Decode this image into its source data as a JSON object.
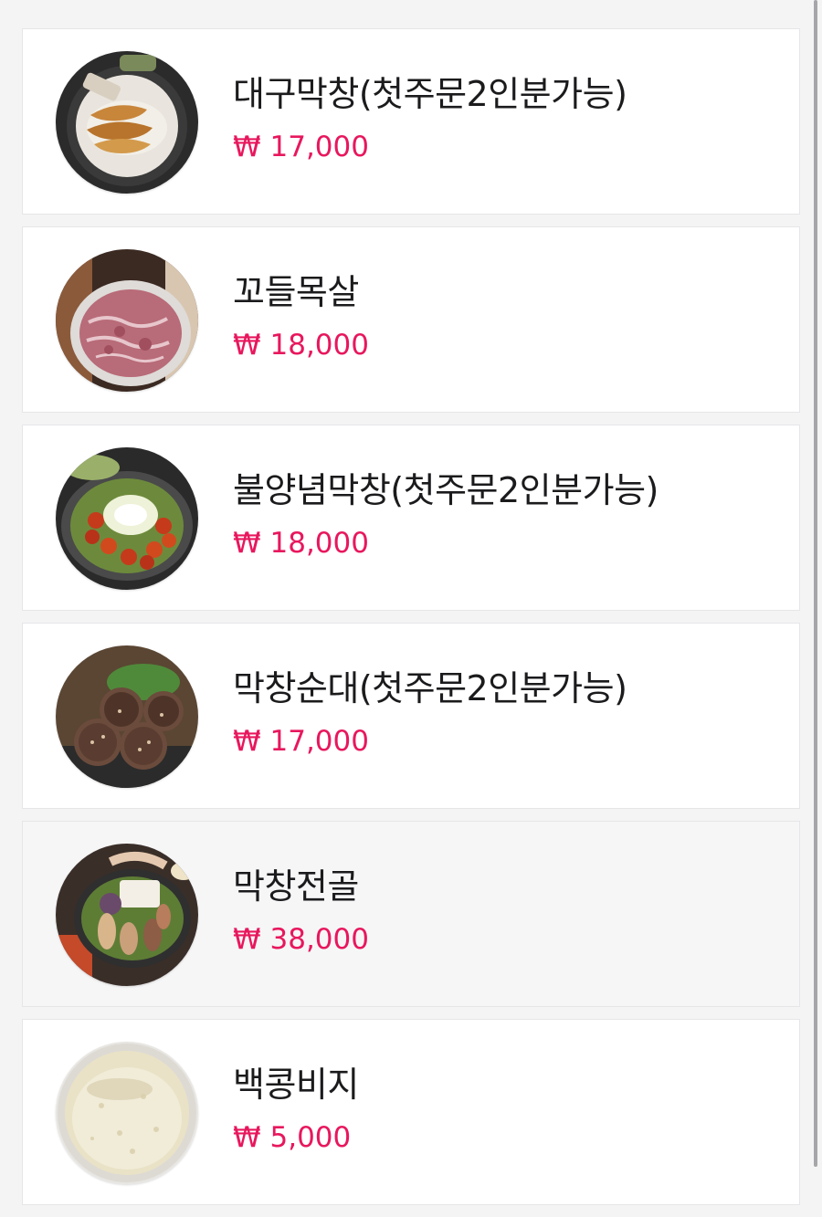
{
  "colors": {
    "price": "#e8175d",
    "name": "#1b1b1d",
    "background": "#f4f4f5",
    "card": "#ffffff"
  },
  "menu": {
    "items": [
      {
        "name": "대구막창(첫주문2인분가능)",
        "price": "₩ 17,000",
        "image": "grilled-makchang-photo"
      },
      {
        "name": "꼬들목살",
        "price": "₩ 18,000",
        "image": "pork-neck-photo"
      },
      {
        "name": "불양념막창(첫주문2인분가능)",
        "price": "₩ 18,000",
        "image": "spicy-makchang-photo"
      },
      {
        "name": "막창순대(첫주문2인분가능)",
        "price": "₩ 17,000",
        "image": "makchang-sundae-photo"
      },
      {
        "name": "막창전골",
        "price": "₩ 38,000",
        "image": "makchang-hotpot-photo"
      },
      {
        "name": "백콩비지",
        "price": "₩ 5,000",
        "image": "soybean-pulp-photo"
      }
    ]
  }
}
